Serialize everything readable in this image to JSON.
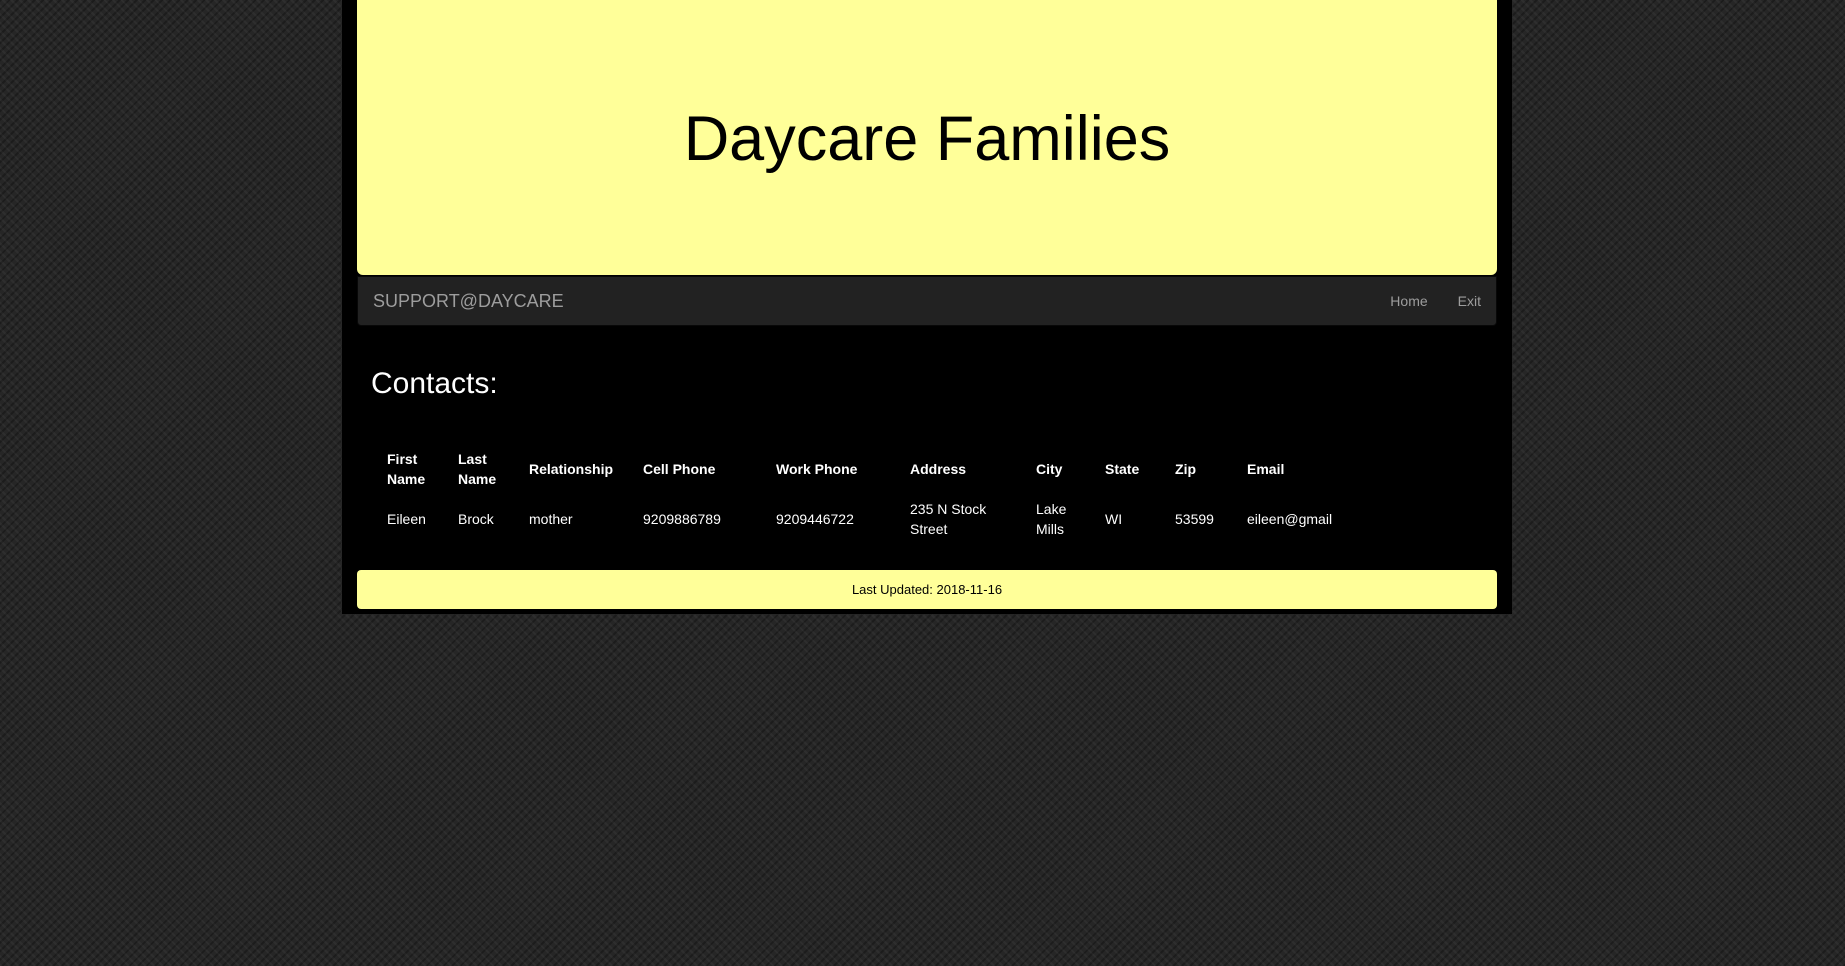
{
  "header": {
    "title": "Daycare Families"
  },
  "navbar": {
    "brand": "SUPPORT@DAYCARE",
    "links": [
      "Home",
      "Exit"
    ]
  },
  "main": {
    "heading": "Contacts:",
    "table": {
      "columns": [
        "First Name",
        "Last Name",
        "Relationship",
        "Cell Phone",
        "Work Phone",
        "Address",
        "City",
        "State",
        "Zip",
        "Email"
      ],
      "rows": [
        [
          "Eileen",
          "Brock",
          "mother",
          "9209886789",
          "9209446722",
          "235 N Stock Street",
          "Lake Mills",
          "WI",
          "53599",
          "eileen@gmail"
        ]
      ]
    }
  },
  "footer": {
    "text": "Last Updated: 2018-11-16"
  },
  "colors": {
    "page_background": "#262626",
    "container": "#000000",
    "jumbotron": "#ffff99",
    "navbar": "#222222",
    "nav_text": "#9d9d9d",
    "table_text": "#ffffff"
  }
}
